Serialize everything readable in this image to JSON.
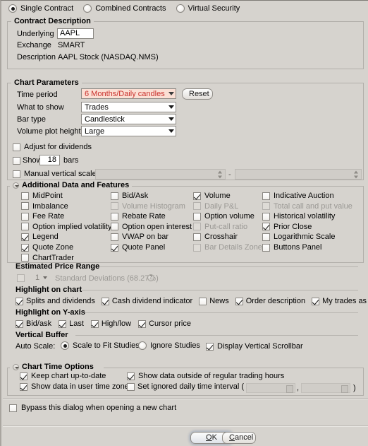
{
  "contract_type": {
    "options": [
      {
        "label": "Single Contract",
        "selected": true
      },
      {
        "label": "Combined Contracts",
        "selected": false
      },
      {
        "label": "Virtual Security",
        "selected": false
      }
    ]
  },
  "contract_description": {
    "title": "Contract Description",
    "underlying_label": "Underlying",
    "underlying_value": "AAPL",
    "exchange_label": "Exchange",
    "exchange_value": "SMART",
    "description_label": "Description",
    "description_value": "AAPL Stock (NASDAQ.NMS)"
  },
  "chart_parameters": {
    "title": "Chart Parameters",
    "time_period_label": "Time period",
    "time_period_value": "6 Months/Daily candles",
    "time_period_color": "#c9302c",
    "time_period_bg": "#fbdfd4",
    "reset_label": "Reset",
    "what_to_show_label": "What to show",
    "what_to_show_value": "Trades",
    "bar_type_label": "Bar type",
    "bar_type_value": "Candlestick",
    "volume_plot_height_label": "Volume plot height",
    "volume_plot_height_value": "Large",
    "adjust_dividends_label": "Adjust for dividends",
    "adjust_dividends_checked": false,
    "show_bars_label": "Show",
    "show_bars_value": "18",
    "bars_suffix_label": "bars",
    "show_bars_checked": false,
    "manual_vertical_scale_label": "Manual vertical scale",
    "manual_vertical_scale_checked": false,
    "range_separator": "-"
  },
  "additional_data": {
    "title": "Additional Data and Features",
    "items": [
      {
        "label": "MidPoint",
        "checked": false,
        "disabled": false,
        "col": 0,
        "row": 0
      },
      {
        "label": "Imbalance",
        "checked": false,
        "disabled": false,
        "col": 0,
        "row": 1
      },
      {
        "label": "Fee Rate",
        "checked": false,
        "disabled": false,
        "col": 0,
        "row": 2
      },
      {
        "label": "Option implied volatility",
        "checked": false,
        "disabled": false,
        "col": 0,
        "row": 3
      },
      {
        "label": "Legend",
        "checked": true,
        "disabled": false,
        "col": 0,
        "row": 4
      },
      {
        "label": "Quote Zone",
        "checked": true,
        "disabled": false,
        "col": 0,
        "row": 5
      },
      {
        "label": "ChartTrader",
        "checked": false,
        "disabled": false,
        "col": 0,
        "row": 6
      },
      {
        "label": "Bid/Ask",
        "checked": false,
        "disabled": false,
        "col": 1,
        "row": 0
      },
      {
        "label": "Volume Histogram",
        "checked": false,
        "disabled": true,
        "col": 1,
        "row": 1
      },
      {
        "label": "Rebate Rate",
        "checked": false,
        "disabled": false,
        "col": 1,
        "row": 2
      },
      {
        "label": "Option open interest",
        "checked": false,
        "disabled": false,
        "col": 1,
        "row": 3
      },
      {
        "label": "VWAP on bar",
        "checked": false,
        "disabled": false,
        "col": 1,
        "row": 4
      },
      {
        "label": "Quote Panel",
        "checked": true,
        "disabled": false,
        "col": 1,
        "row": 5
      },
      {
        "label": "Volume",
        "checked": true,
        "disabled": false,
        "col": 2,
        "row": 0
      },
      {
        "label": "Daily P&L",
        "checked": false,
        "disabled": true,
        "col": 2,
        "row": 1
      },
      {
        "label": "Option volume",
        "checked": false,
        "disabled": false,
        "col": 2,
        "row": 2
      },
      {
        "label": "Put-call ratio",
        "checked": false,
        "disabled": true,
        "col": 2,
        "row": 3
      },
      {
        "label": "Crosshair",
        "checked": false,
        "disabled": false,
        "col": 2,
        "row": 4
      },
      {
        "label": "Bar Details Zone",
        "checked": false,
        "disabled": true,
        "col": 2,
        "row": 5
      },
      {
        "label": "Indicative Auction",
        "checked": false,
        "disabled": false,
        "col": 3,
        "row": 0
      },
      {
        "label": "Total call and put value",
        "checked": false,
        "disabled": true,
        "col": 3,
        "row": 1
      },
      {
        "label": "Historical volatility",
        "checked": false,
        "disabled": false,
        "col": 3,
        "row": 2
      },
      {
        "label": "Prior Close",
        "checked": true,
        "disabled": false,
        "col": 3,
        "row": 3
      },
      {
        "label": "Logarithmic Scale",
        "checked": false,
        "disabled": false,
        "col": 3,
        "row": 4
      },
      {
        "label": "Buttons Panel",
        "checked": false,
        "disabled": false,
        "col": 3,
        "row": 5
      }
    ]
  },
  "estimated_price_range": {
    "title": "Estimated Price Range",
    "checked": false,
    "std_dev_value": "1",
    "std_dev_label": "Standard Deviations (68.27%)"
  },
  "highlight_on_chart": {
    "title": "Highlight on chart",
    "items": [
      {
        "label": "Splits and dividends",
        "checked": true
      },
      {
        "label": "Cash dividend indicator",
        "checked": true
      },
      {
        "label": "News",
        "checked": false
      },
      {
        "label": "Order description",
        "checked": true
      },
      {
        "label": "My trades as",
        "checked": true
      }
    ]
  },
  "highlight_on_yaxis": {
    "title": "Highlight on Y-axis",
    "items": [
      {
        "label": "Bid/ask",
        "checked": true
      },
      {
        "label": "Last",
        "checked": true
      },
      {
        "label": "High/low",
        "checked": true
      },
      {
        "label": "Cursor price",
        "checked": true
      }
    ]
  },
  "vertical_buffer": {
    "title": "Vertical Buffer",
    "auto_scale_label": "Auto Scale:",
    "radios": [
      {
        "label": "Scale to Fit Studies",
        "selected": true
      },
      {
        "label": "Ignore Studies",
        "selected": false
      }
    ],
    "display_scrollbar_label": "Display Vertical Scrollbar",
    "display_scrollbar_checked": true
  },
  "chart_time_options": {
    "title": "Chart Time Options",
    "keep_up_to_date_label": "Keep chart up-to-date",
    "keep_up_to_date_checked": true,
    "show_outside_rth_label": "Show data outside of regular trading hours",
    "show_outside_rth_checked": true,
    "user_time_zone_label": "Show data in user time zone",
    "user_time_zone_checked": true,
    "ignored_interval_label": "Set ignored daily time interval (",
    "ignored_interval_checked": false,
    "ignored_interval_comma": ",",
    "ignored_interval_close": ")"
  },
  "bypass": {
    "label": "Bypass this dialog when opening a new chart",
    "checked": false
  },
  "footer": {
    "ok_label": "OK",
    "ok_mnemonic": "O",
    "cancel_label": "Cancel",
    "cancel_mnemonic": "C"
  }
}
